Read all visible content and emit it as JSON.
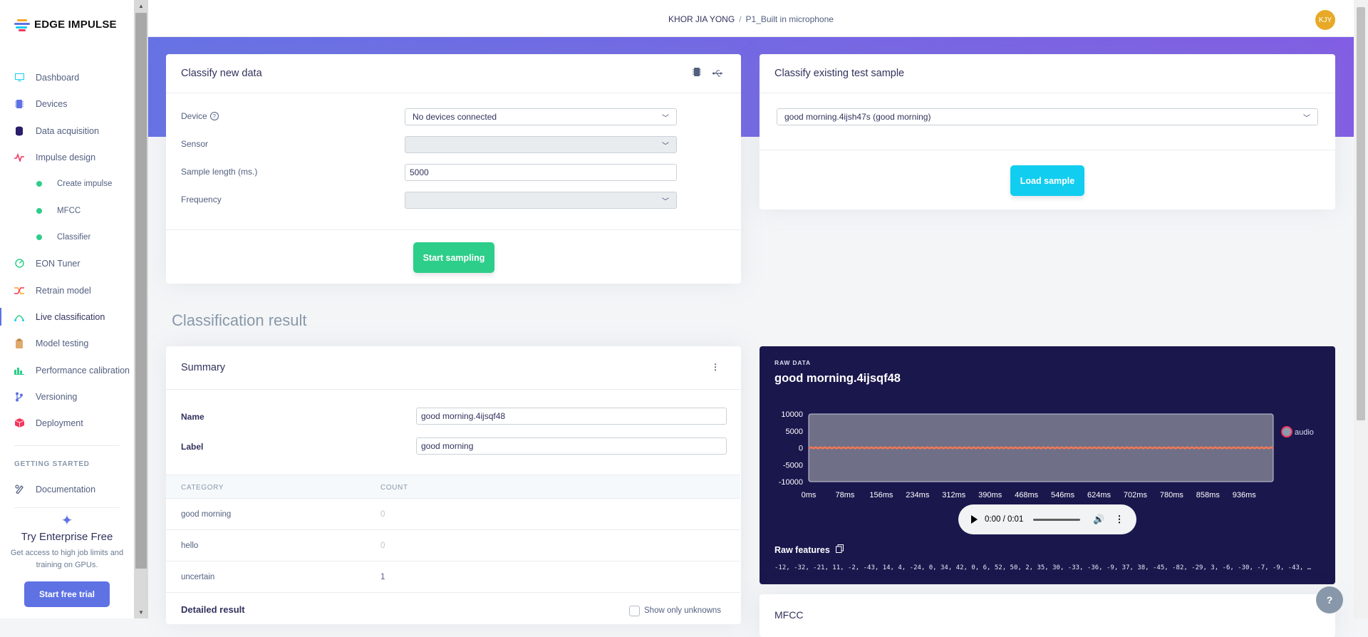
{
  "app": {
    "logo_text": "EDGE IMPULSE"
  },
  "breadcrumb": {
    "owner": "KHOR JIA YONG",
    "separator": "/",
    "project": "P1_Built in microphone"
  },
  "avatar": {
    "initials": "KJY",
    "color": "#e7a927"
  },
  "sidebar": {
    "items": [
      {
        "label": "Dashboard",
        "icon": "monitor-icon"
      },
      {
        "label": "Devices",
        "icon": "chip-icon"
      },
      {
        "label": "Data acquisition",
        "icon": "database-icon"
      },
      {
        "label": "Impulse design",
        "icon": "pulse-icon"
      },
      {
        "label": "Create impulse",
        "icon": "dot-icon"
      },
      {
        "label": "MFCC",
        "icon": "dot-icon"
      },
      {
        "label": "Classifier",
        "icon": "dot-icon"
      },
      {
        "label": "EON Tuner",
        "icon": "tuner-icon"
      },
      {
        "label": "Retrain model",
        "icon": "shuffle-icon"
      },
      {
        "label": "Live classification",
        "icon": "live-icon"
      },
      {
        "label": "Model testing",
        "icon": "clipboard-icon"
      },
      {
        "label": "Performance calibration",
        "icon": "bars-icon"
      },
      {
        "label": "Versioning",
        "icon": "branch-icon"
      },
      {
        "label": "Deployment",
        "icon": "box-icon"
      }
    ],
    "getting_started_title": "GETTING STARTED",
    "documentation": "Documentation",
    "enterprise": {
      "title": "Try Enterprise Free",
      "description": "Get access to high job limits and training on GPUs.",
      "button": "Start free trial"
    }
  },
  "classify_new": {
    "title": "Classify new data",
    "device_label": "Device",
    "device_value": "No devices connected",
    "sensor_label": "Sensor",
    "sensor_value": "",
    "sample_length_label": "Sample length (ms.)",
    "sample_length_value": "5000",
    "frequency_label": "Frequency",
    "frequency_value": "",
    "start_button": "Start sampling"
  },
  "classify_existing": {
    "title": "Classify existing test sample",
    "sample_value": "good morning.4ijsh47s (good morning)",
    "load_button": "Load sample"
  },
  "classification_result": {
    "heading": "Classification result",
    "summary_title": "Summary",
    "name_label": "Name",
    "name_value": "good morning.4ijsqf48",
    "label_label": "Label",
    "label_value": "good morning",
    "table_headers": [
      "CATEGORY",
      "COUNT"
    ],
    "rows": [
      {
        "category": "good morning",
        "count": "0"
      },
      {
        "category": "hello",
        "count": "0"
      },
      {
        "category": "uncertain",
        "count": "1"
      }
    ],
    "detailed_title": "Detailed result",
    "show_unknowns_label": "Show only unknowns"
  },
  "raw_data": {
    "label": "RAW DATA",
    "title": "good morning.4ijsqf48",
    "audio_time": "0:00 / 0:01",
    "raw_features_title": "Raw features",
    "raw_features_values": "-12, -32, -21, 11, -2, -43, 14, 4, -24, 0, 34, 42, 0, 6, 52, 50, 2, 35, 30, -33, -36, -9, 37, 38, -45, -82, -29, 3, -6, -30, -7, -9, -43, …"
  },
  "mfcc": {
    "title": "MFCC"
  },
  "chart_data": {
    "type": "line",
    "title": "",
    "y_ticks": [
      "10000",
      "5000",
      "0",
      "-5000",
      "-10000"
    ],
    "x_ticks": [
      "0ms",
      "78ms",
      "156ms",
      "234ms",
      "312ms",
      "390ms",
      "468ms",
      "546ms",
      "624ms",
      "702ms",
      "780ms",
      "858ms",
      "936ms"
    ],
    "ylim": [
      -10000,
      10000
    ],
    "series": [
      {
        "name": "audio",
        "color": "#f07857",
        "values": [
          0,
          0
        ]
      }
    ],
    "legend_position": "right"
  },
  "colors": {
    "primary": "#5e72e4",
    "success": "#2dce89",
    "info": "#11cdef",
    "raw_panel": "#1a174d"
  }
}
